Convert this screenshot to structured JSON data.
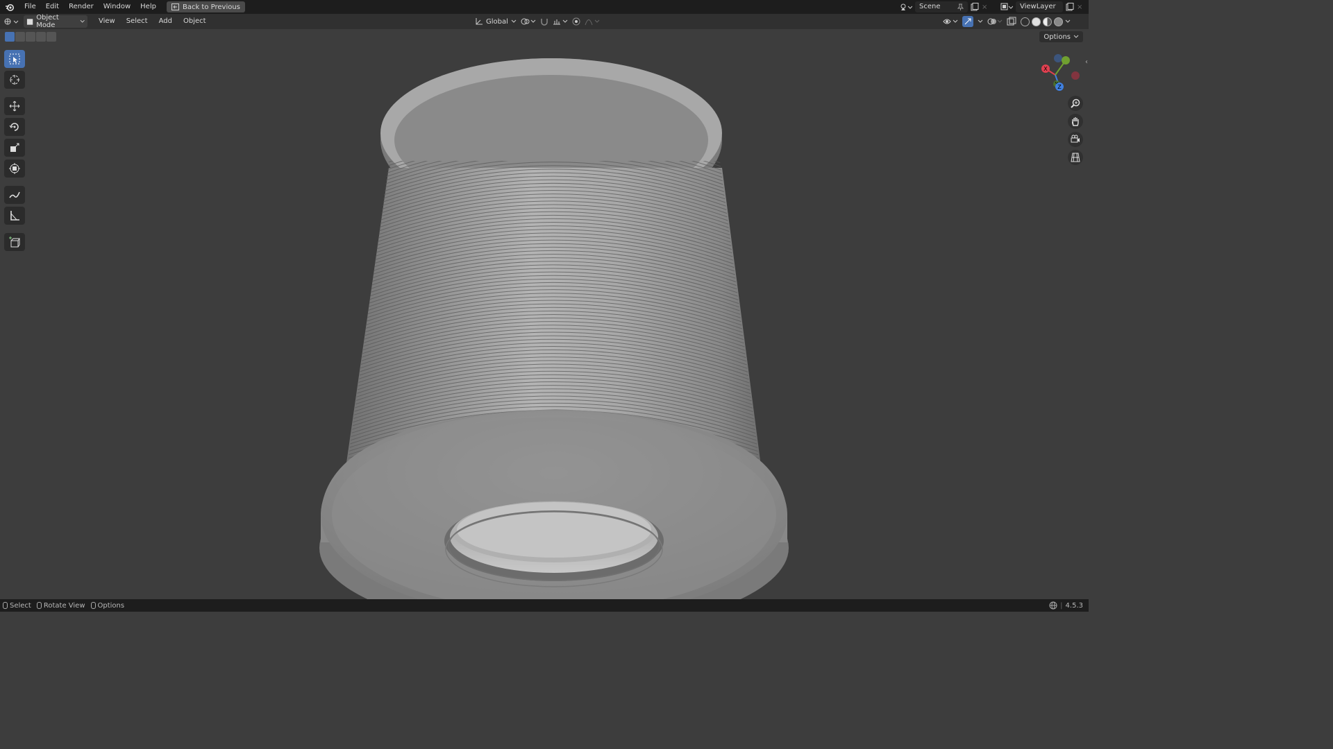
{
  "topbar": {
    "menu": [
      "File",
      "Edit",
      "Render",
      "Window",
      "Help"
    ],
    "back_button": "Back to Previous",
    "scene": "Scene",
    "view_layer": "ViewLayer"
  },
  "header": {
    "mode": "Object Mode",
    "menus": [
      "View",
      "Select",
      "Add",
      "Object"
    ],
    "transform_orientation": "Global"
  },
  "viewport": {
    "options_label": "Options",
    "tools": [
      "select-box",
      "cursor",
      "move",
      "rotate",
      "scale",
      "transform",
      "annotate",
      "measure",
      "add-cube"
    ],
    "gizmo_axes": {
      "x": "X",
      "y": "Y",
      "z": "Z"
    }
  },
  "statusbar": {
    "items": [
      "Select",
      "Rotate View",
      "Options"
    ],
    "version": "4.5.3"
  },
  "colors": {
    "accent": "#4772b3",
    "axis_x": "#e04050",
    "axis_y": "#70a030",
    "axis_z": "#4080e0"
  }
}
